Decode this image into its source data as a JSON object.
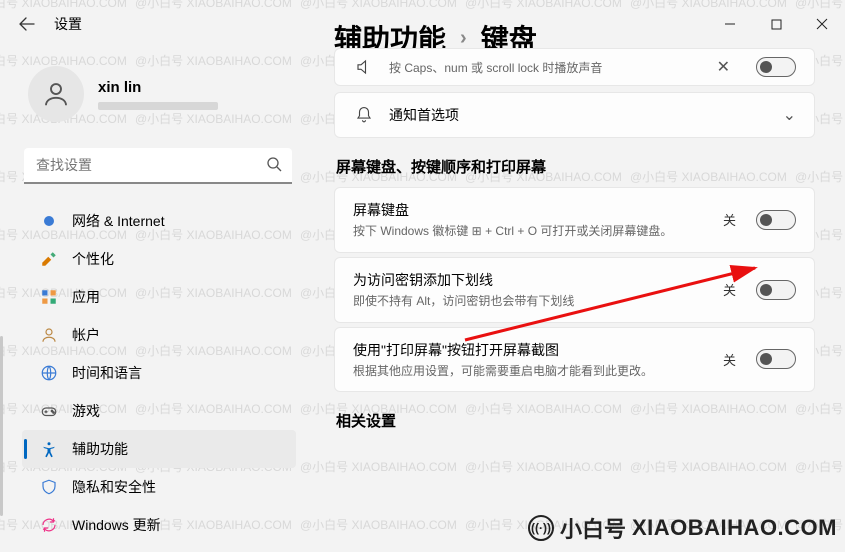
{
  "app": {
    "title": "设置"
  },
  "breadcrumb": {
    "parent": "辅助功能",
    "sep": "›",
    "current": "键盘"
  },
  "user": {
    "name": "xin lin"
  },
  "search": {
    "placeholder": "查找设置"
  },
  "sidebar": {
    "items": [
      {
        "label": "网络 & Internet",
        "icon": "#1f6feb"
      },
      {
        "label": "个性化",
        "icon": "brush"
      },
      {
        "label": "应用",
        "icon": "apps"
      },
      {
        "label": "帐户",
        "icon": "account"
      },
      {
        "label": "时间和语言",
        "icon": "globe"
      },
      {
        "label": "游戏",
        "icon": "game"
      },
      {
        "label": "辅助功能",
        "icon": "access",
        "active": true
      },
      {
        "label": "隐私和安全性",
        "icon": "shield"
      },
      {
        "label": "Windows 更新",
        "icon": "update"
      }
    ]
  },
  "main": {
    "partial_card_sub": "按 Caps、num 或 scroll lock 时播放声音",
    "notify_card_title": "通知首选项",
    "section": "屏幕键盘、按键顺序和打印屏幕",
    "cards": [
      {
        "title": "屏幕键盘",
        "sub": "按下 Windows 徽标键 ⊞ + Ctrl + O 可打开或关闭屏幕键盘。",
        "state": "关"
      },
      {
        "title": "为访问密钥添加下划线",
        "sub": "即使不持有 Alt，访问密钥也会带有下划线",
        "state": "关"
      },
      {
        "title": "使用\"打印屏幕\"按钮打开屏幕截图",
        "sub": "根据其他应用设置，可能需要重启电脑才能看到此更改。",
        "state": "关"
      }
    ],
    "related": "相关设置"
  },
  "watermark": {
    "text": "@小白号  XIAOBAIHAO.COM",
    "brand": "小白号",
    "domain": "XIAOBAIHAO.COM"
  }
}
